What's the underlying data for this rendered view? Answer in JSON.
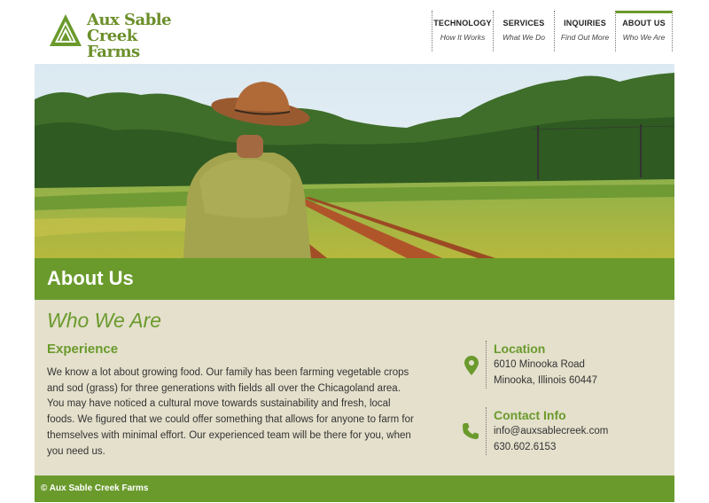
{
  "logo": {
    "line1": "Aux Sable",
    "line2": "Creek Farms"
  },
  "nav": [
    {
      "title": "TECHNOLOGY",
      "sub": "How It Works"
    },
    {
      "title": "SERVICES",
      "sub": "What We Do"
    },
    {
      "title": "INQUIRIES",
      "sub": "Find Out More"
    },
    {
      "title": "ABOUT US",
      "sub": "Who We Are"
    }
  ],
  "banner": {
    "title": "About Us"
  },
  "content": {
    "section_title": "Who We Are",
    "experience_title": "Experience",
    "experience_body": "We know a lot about growing food. Our family has been farming vegetable crops and sod (grass) for three generations with fields all over the Chicagoland area. You may have noticed a cultural move towards sustainability and fresh, local foods. We figured that we could offer something that allows for anyone to farm for themselves with minimal effort. Our experienced team will be there for you, when you need us."
  },
  "location": {
    "title": "Location",
    "street": "6010 Minooka Road",
    "city": "Minooka, Illinois 60447"
  },
  "contact": {
    "title": "Contact Info",
    "email": "info@auxsablecreek.com",
    "phone": "630.602.6153"
  },
  "footer": {
    "text": "© Aux Sable Creek Farms"
  },
  "colors": {
    "accent": "#6a9a2c",
    "content_bg": "#e4e0cc"
  },
  "icons": {
    "location": "map-pin-icon",
    "contact": "phone-icon"
  }
}
